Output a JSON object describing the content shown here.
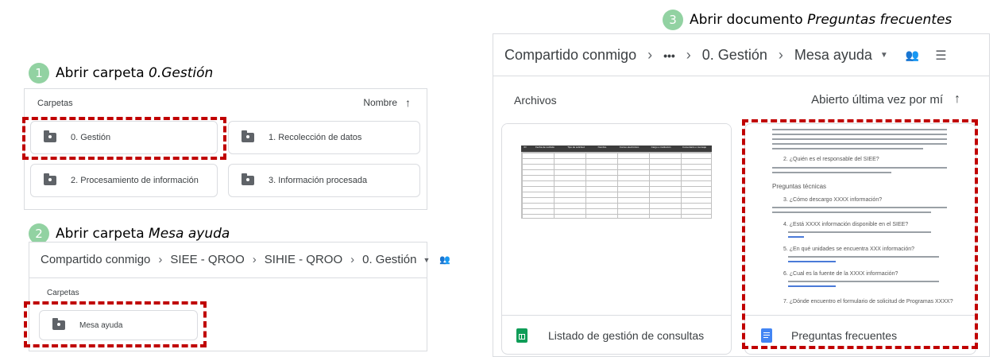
{
  "step1": {
    "number": "1",
    "text": "Abrir carpeta ",
    "italic": "0.Gestión"
  },
  "step2": {
    "number": "2",
    "text": "Abrir carpeta ",
    "italic": "Mesa ayuda"
  },
  "step3": {
    "number": "3",
    "text": "Abrir documento ",
    "italic": "Preguntas frecuentes"
  },
  "panel1": {
    "header_left": "Carpetas",
    "header_right": "Nombre",
    "sort_icon": "arrow-up-icon",
    "folders": [
      "0. Gestión",
      "1. Recolección de datos",
      "2. Procesamiento de información",
      "3. Información procesada"
    ]
  },
  "panel2": {
    "breadcrumb": [
      "Compartido conmigo",
      "SIEE - QROO",
      "SIHIE - QROO",
      "0. Gestión"
    ],
    "section": "Carpetas",
    "folder": "Mesa ayuda"
  },
  "panel3": {
    "breadcrumb": [
      "Compartido conmigo",
      "•••",
      "0. Gestión",
      "Mesa ayuda"
    ],
    "section": "Archivos",
    "sort_label": "Abierto última vez por mí",
    "files": [
      {
        "name": "Listado de gestión de consultas",
        "icon": "sheets-icon",
        "color": "#0f9d58"
      },
      {
        "name": "Preguntas frecuentes",
        "icon": "docs-icon",
        "color": "#4285f4"
      }
    ],
    "sheet_headers": [
      "ID",
      "Fecha de recibido",
      "Tipo de solicitud",
      "Nombre",
      "Correo electrónico",
      "Cargo e institución",
      "Comentario o mensaje"
    ],
    "doc_questions": [
      "2. ¿Quién es el responsable del SIEE?",
      "Preguntas técnicas",
      "3. ¿Cómo descargo XXXX información?",
      "4. ¿Está XXXX información disponible en el SIEE?",
      "5. ¿En qué unidades se encuentra XXX información?",
      "6. ¿Cual es la fuente de la XXXX información?",
      "7. ¿Dónde encuentro el formulario de solicitud de Programas XXXX?"
    ]
  }
}
